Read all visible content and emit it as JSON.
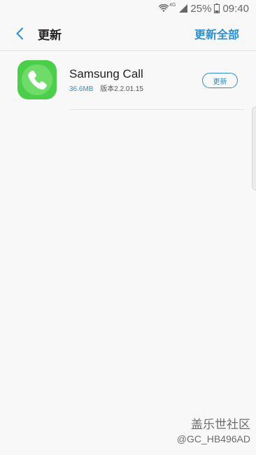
{
  "status_bar": {
    "network": "4G",
    "battery_percent": "25%",
    "time": "09:40",
    "icons": [
      "wifi-icon",
      "signal-icon",
      "battery-icon"
    ]
  },
  "header": {
    "title": "更新",
    "update_all_label": "更新全部",
    "accent_color": "#2a8fd0"
  },
  "updates": [
    {
      "app_name": "Samsung Call",
      "size": "36.6MB",
      "version": "版本2.2.01.15",
      "update_label": "更新",
      "icon": "phone-icon"
    }
  ],
  "watermark": {
    "line1": "盖乐世社区",
    "line2": "@GC_HB496AD"
  }
}
